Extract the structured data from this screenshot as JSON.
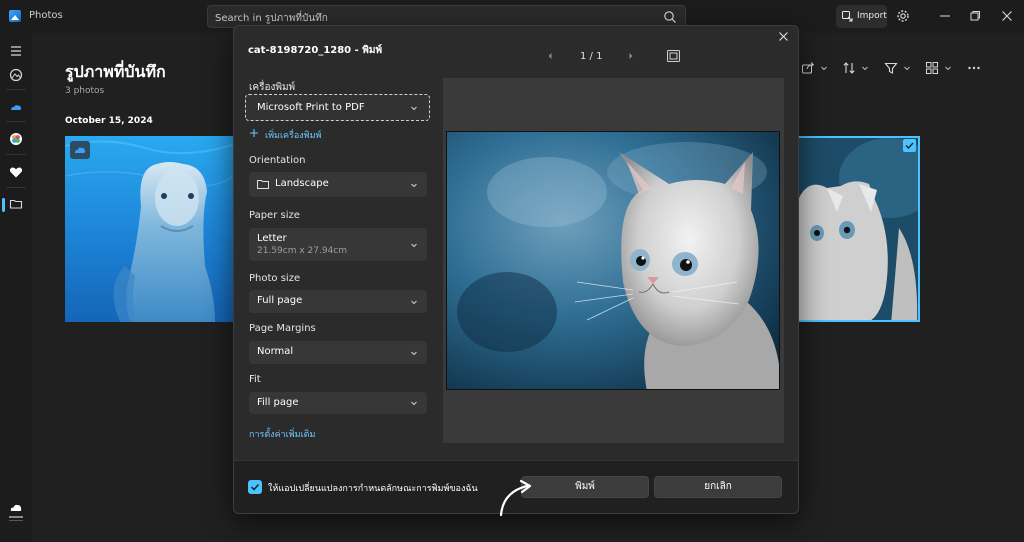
{
  "app": {
    "title": "Photos",
    "search_placeholder": "Search in รูปภาพที่บันทึก",
    "import_label": "Import"
  },
  "gallery": {
    "title": "รูปภาพที่บันทึก",
    "count": "3 photos",
    "date": "October 15, 2024"
  },
  "dialog": {
    "title": "cat-8198720_1280 - พิมพ์",
    "page_indicator": "1 / 1",
    "printer": {
      "label": "เครื่องพิมพ์",
      "value": "Microsoft Print to PDF",
      "add_label": "เพิ่มเครื่องพิมพ์"
    },
    "orientation": {
      "label": "Orientation",
      "value": "Landscape"
    },
    "paper_size": {
      "label": "Paper size",
      "value": "Letter",
      "detail": "21.59cm x 27.94cm"
    },
    "photo_size": {
      "label": "Photo size",
      "value": "Full page"
    },
    "page_margins": {
      "label": "Page Margins",
      "value": "Normal"
    },
    "fit": {
      "label": "Fit",
      "value": "Fill page"
    },
    "more_settings": "การตั้งค่าเพิ่มเติม",
    "footer": {
      "checkbox_label": "ให้แอปเปลี่ยนแปลงการกำหนดลักษณะการพิมพ์ของฉัน",
      "checked": true,
      "print_button": "พิมพ์",
      "cancel_button": "ยกเลิก"
    }
  },
  "colors": {
    "accent": "#4cc2ff",
    "link": "#6fc6ff",
    "dialog_bg": "#2b2b2b",
    "app_bg": "#1c1c1c"
  },
  "icons": {
    "rail": [
      "hamburger-icon",
      "gallery-icon",
      "onedrive-icon",
      "apple-icloud-icon",
      "favorites-icon",
      "folders-icon",
      "cloud-status-icon"
    ],
    "toolbar": [
      "share-icon",
      "sort-icon",
      "filter-icon",
      "view-icon",
      "more-icon"
    ]
  }
}
